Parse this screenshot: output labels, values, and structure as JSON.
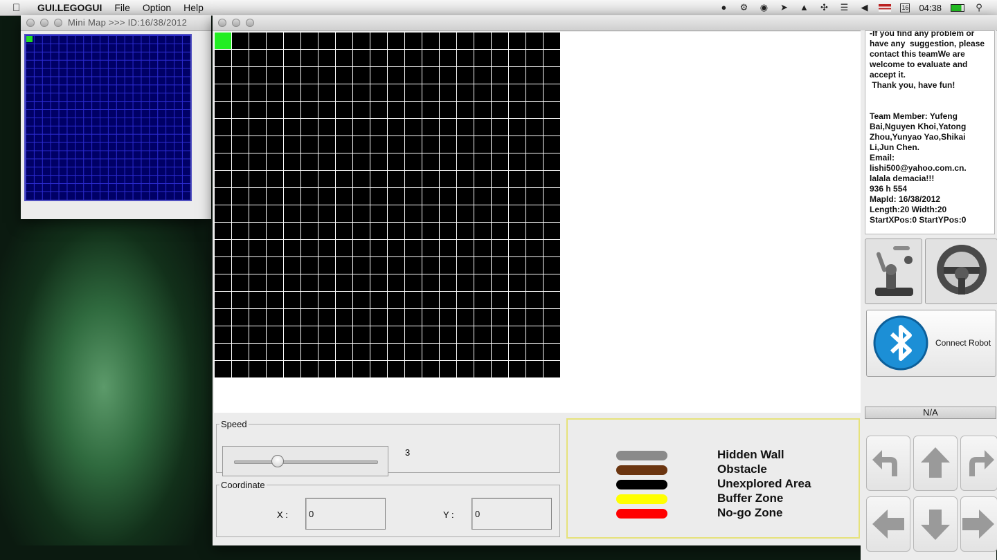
{
  "menubar": {
    "app_name": "GUI.LEGOGUI",
    "menus": [
      "File",
      "Option",
      "Help"
    ],
    "calendar_day": "16",
    "clock": "04:38"
  },
  "minimap_window": {
    "title": "Mini Map >>> ID:16/38/2012",
    "grid": {
      "rows": 20,
      "cols": 20
    },
    "colors": {
      "background": "#000066",
      "grid_lines": "#2b2bd0",
      "start_cell": "#22dd22"
    }
  },
  "main_window": {
    "title": "",
    "map": {
      "rows": 20,
      "cols": 20,
      "start_cell": [
        0,
        0
      ],
      "colors": {
        "unexplored": "#000000",
        "grid_lines": "#ffffff",
        "start_cell": "#22ee22"
      }
    }
  },
  "speed": {
    "group_label": "Speed",
    "value": "3",
    "level": 3
  },
  "coordinate": {
    "group_label": "Coordinate",
    "x_label": "X :",
    "x_value": "0",
    "y_label": "Y :",
    "y_value": "0"
  },
  "legend": {
    "items": [
      {
        "label": "Hidden Wall",
        "color": "#8a8a8a"
      },
      {
        "label": "Obstacle",
        "color": "#6b3510"
      },
      {
        "label": "Unexplored Area",
        "color": "#000000"
      },
      {
        "label": "Buffer Zone",
        "color": "#ffff00"
      },
      {
        "label": "No-go Zone",
        "color": "#ff0000"
      }
    ]
  },
  "info_panel": {
    "text": "-If you find any problem or have any  suggestion, please contact this teamWe are welcome to evaluate and accept it.\n Thank you, have fun!\n\n\nTeam Member: Yufeng Bai,Nguyen Khoi,Yatong Zhou,Yunyao Yao,Shikai Li,Jun Chen.\nEmail:\nlishi500@yahoo.com.cn.\nlalala demacia!!!\n936 h 554\nMapId: 16/38/2012\nLength:20 Width:20\nStartXPos:0 StartYPos:0"
  },
  "buttons": {
    "robot_arm_icon": "robot-arm-icon",
    "steering_wheel_icon": "steering-wheel-icon",
    "connect_robot": "Connect Robot",
    "status": "N/A"
  },
  "controls": [
    "turn-left",
    "forward",
    "turn-right",
    "left",
    "backward",
    "right"
  ]
}
